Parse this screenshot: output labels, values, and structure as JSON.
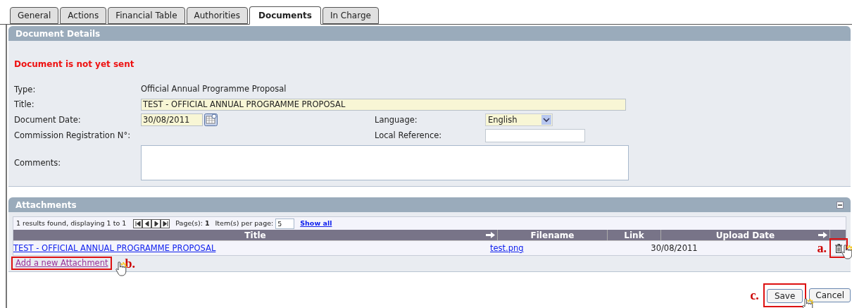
{
  "tabs": [
    {
      "label": "General",
      "selected": false
    },
    {
      "label": "Actions",
      "selected": false
    },
    {
      "label": "Financial Table",
      "selected": false
    },
    {
      "label": "Authorities",
      "selected": false
    },
    {
      "label": "Documents",
      "selected": true
    },
    {
      "label": "In Charge",
      "selected": false
    }
  ],
  "document_details": {
    "title": "Document Details",
    "status": "Document is not yet sent",
    "type": {
      "label": "Type:",
      "value": "Official Annual Programme Proposal"
    },
    "title_field": {
      "label": "Title:",
      "value": "TEST - OFFICIAL ANNUAL PROGRAMME PROPOSAL"
    },
    "document_date": {
      "label": "Document Date:",
      "value": "30/08/2011"
    },
    "language": {
      "label": "Language:",
      "value": "English"
    },
    "commission_registration": {
      "label": "Commission Registration N°:"
    },
    "local_reference": {
      "label": "Local Reference:"
    },
    "comments": {
      "label": "Comments:"
    }
  },
  "attachments": {
    "title": "Attachments",
    "pager": {
      "summary": "1 results found, displaying 1 to 1",
      "pages_label": "Page(s):",
      "pages_value": "1",
      "per_page_label": "Item(s) per page:",
      "per_page_value": "5",
      "show_all": "Show all"
    },
    "columns": [
      {
        "label": "Title",
        "sortable": true
      },
      {
        "label": "Filename",
        "sortable": false
      },
      {
        "label": "Link",
        "sortable": false
      },
      {
        "label": "Upload Date",
        "sortable": true
      }
    ],
    "rows": [
      {
        "title": "TEST - OFFICIAL ANNUAL PROGRAMME PROPOSAL",
        "filename": "test.png",
        "upload_date": "30/08/2011"
      }
    ],
    "add_link": "Add a new Attachment"
  },
  "annotations": [
    {
      "label": "a."
    },
    {
      "label": "b."
    },
    {
      "label": "c."
    }
  ],
  "buttons": [
    {
      "label": "Save"
    },
    {
      "label": "Cancel"
    }
  ]
}
